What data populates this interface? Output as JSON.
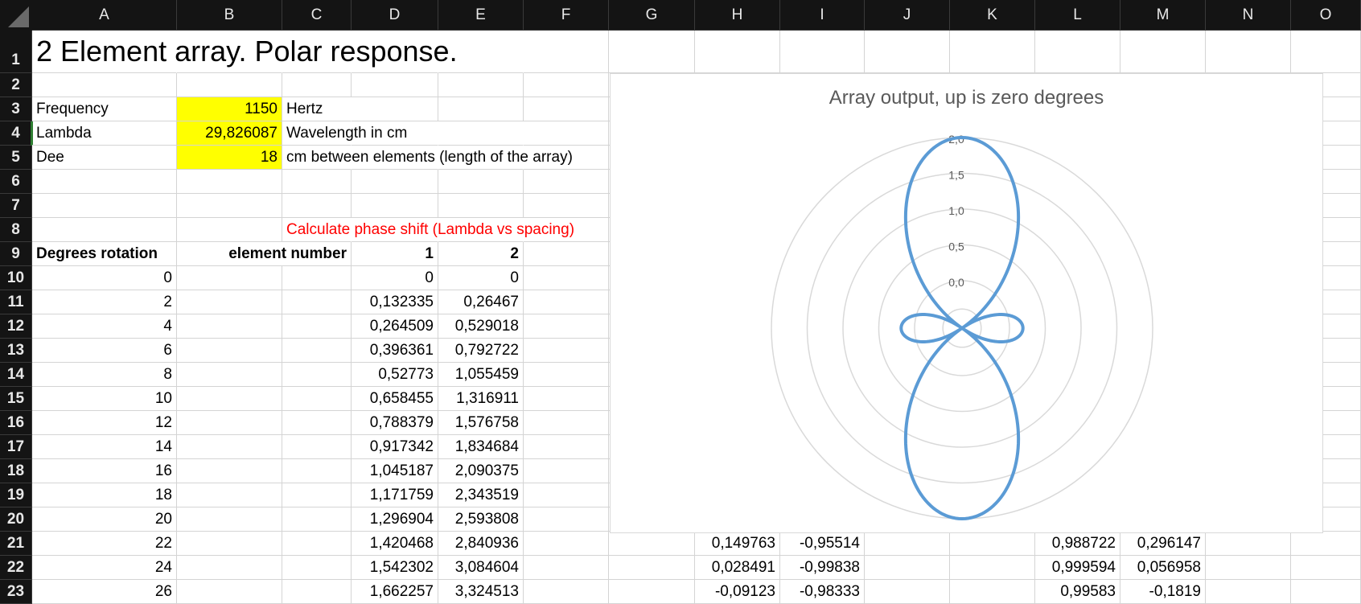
{
  "columns": [
    "A",
    "B",
    "C",
    "D",
    "E",
    "F",
    "G",
    "H",
    "I",
    "J",
    "K",
    "L",
    "M",
    "N",
    "O"
  ],
  "rows": [
    "1",
    "2",
    "3",
    "4",
    "5",
    "6",
    "7",
    "8",
    "9",
    "10",
    "11",
    "12",
    "13",
    "14",
    "15",
    "16",
    "17",
    "18",
    "19",
    "20",
    "21",
    "22",
    "23"
  ],
  "title_text": "2 Element array.  Polar response.",
  "params": {
    "frequency_label": "Frequency",
    "frequency_value": "1150",
    "frequency_unit": "Hertz",
    "lambda_label": "Lambda",
    "lambda_value": "29,826087",
    "lambda_unit": "Wavelength in cm",
    "dee_label": "Dee",
    "dee_value": "18",
    "dee_unit": "cm between elements  (length of the array)"
  },
  "phase_note": "Calculate phase shift (Lambda vs spacing)",
  "headers": {
    "degrees": "Degrees rotation",
    "element": "element number",
    "el1": "1",
    "el2": "2"
  },
  "table": [
    {
      "deg": "0",
      "d": "0",
      "e": "0"
    },
    {
      "deg": "2",
      "d": "0,132335",
      "e": "0,26467"
    },
    {
      "deg": "4",
      "d": "0,264509",
      "e": "0,529018"
    },
    {
      "deg": "6",
      "d": "0,396361",
      "e": "0,792722"
    },
    {
      "deg": "8",
      "d": "0,52773",
      "e": "1,055459"
    },
    {
      "deg": "10",
      "d": "0,658455",
      "e": "1,316911"
    },
    {
      "deg": "12",
      "d": "0,788379",
      "e": "1,576758"
    },
    {
      "deg": "14",
      "d": "0,917342",
      "e": "1,834684"
    },
    {
      "deg": "16",
      "d": "1,045187",
      "e": "2,090375"
    },
    {
      "deg": "18",
      "d": "1,171759",
      "e": "2,343519"
    },
    {
      "deg": "20",
      "d": "1,296904",
      "e": "2,593808"
    },
    {
      "deg": "22",
      "d": "1,420468",
      "e": "2,840936",
      "h": "0,149763",
      "i": "-0,95514",
      "l": "0,988722",
      "m": "0,296147"
    },
    {
      "deg": "24",
      "d": "1,542302",
      "e": "3,084604",
      "h": "0,028491",
      "i": "-0,99838",
      "l": "0,999594",
      "m": "0,056958"
    },
    {
      "deg": "26",
      "d": "1,662257",
      "e": "3,324513",
      "h": "-0,09123",
      "i": "-0,98333",
      "l": "0,99583",
      "m": "-0,1819"
    }
  ],
  "chart_data": {
    "type": "polar-line",
    "title": "Array output, up is zero degrees",
    "radial_ticks": [
      "0,0",
      "0,5",
      "1,0",
      "1,5",
      "2,0"
    ],
    "radial_range": [
      0,
      2.0
    ],
    "frequency_hz": 1150,
    "lambda_cm": 29.826087,
    "spacing_cm": 18,
    "angle_step_deg": 2,
    "series": [
      {
        "color": "#5b9bd5"
      }
    ],
    "grid": true
  }
}
